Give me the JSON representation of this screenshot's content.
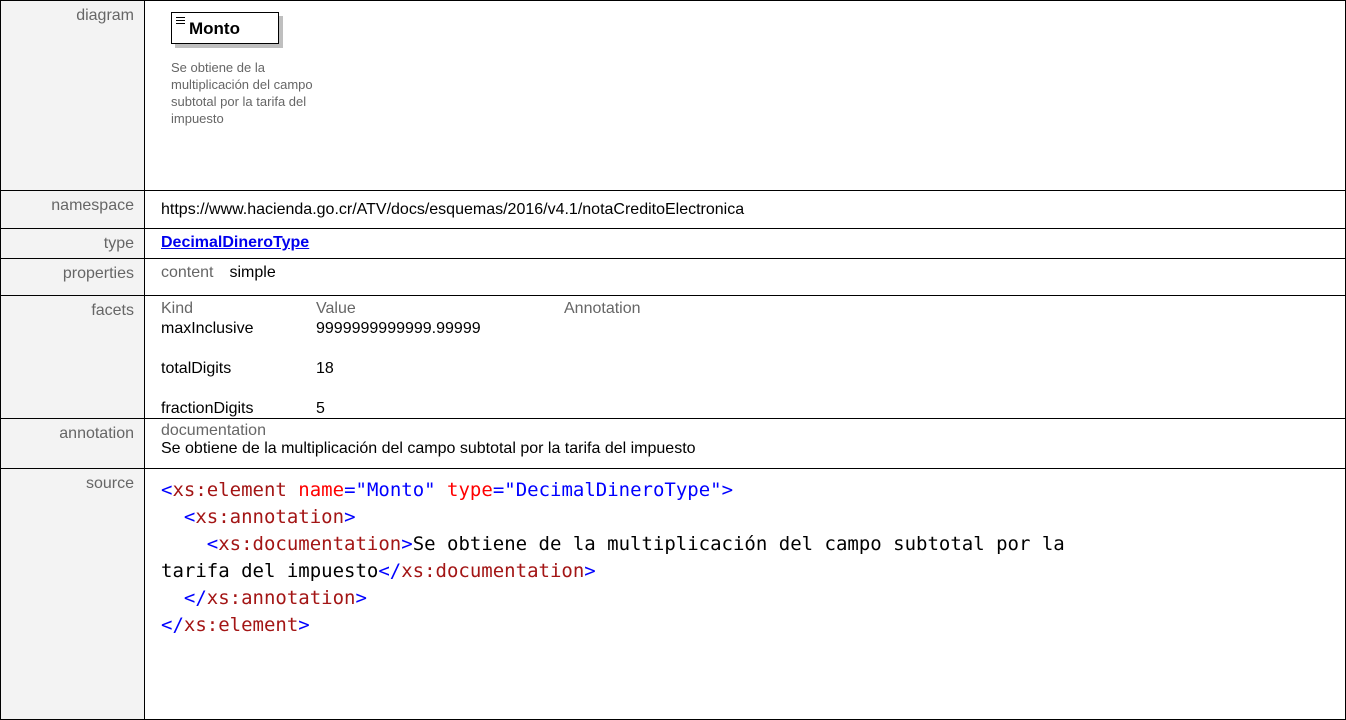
{
  "rows": {
    "diagram": {
      "label": "diagram",
      "element_name": "Monto",
      "doc_lines": [
        "Se obtiene de la",
        "multiplicación del campo",
        "subtotal por la tarifa del",
        "impuesto"
      ]
    },
    "namespace": {
      "label": "namespace",
      "value": "https://www.hacienda.go.cr/ATV/docs/esquemas/2016/v4.1/notaCreditoElectronica"
    },
    "type": {
      "label": "type",
      "value": "DecimalDineroType"
    },
    "properties": {
      "label": "properties",
      "key": "content",
      "value": "simple"
    },
    "facets": {
      "label": "facets",
      "headers": [
        "Kind",
        "Value",
        "Annotation"
      ],
      "items": [
        {
          "kind": "maxInclusive",
          "value": "9999999999999.99999"
        },
        {
          "kind": "totalDigits",
          "value": "18"
        },
        {
          "kind": "fractionDigits",
          "value": "5"
        }
      ]
    },
    "annotation": {
      "label": "annotation",
      "key": "documentation",
      "value": "Se obtiene de la multiplicación del campo subtotal por la tarifa del impuesto"
    },
    "source": {
      "label": "source",
      "line1": {
        "open": "<",
        "tag": "xs:element",
        "attr1": "name",
        "eq1": "=",
        "val1": "\"Monto\"",
        "attr2": "type",
        "eq2": "=",
        "val2": "\"DecimalDineroType\"",
        "close": ">"
      },
      "line2": {
        "open": "<",
        "tag": "xs:annotation",
        "close": ">"
      },
      "line3": {
        "open": "<",
        "tag": "xs:documentation",
        "close": ">",
        "text": "Se obtiene de la multiplicación del campo subtotal por la"
      },
      "line4": {
        "text": "tarifa del impuesto",
        "open": "</",
        "tag": "xs:documentation",
        "close": ">"
      },
      "line5": {
        "open": "</",
        "tag": "xs:annotation",
        "close": ">"
      },
      "line6": {
        "open": "</",
        "tag": "xs:element",
        "close": ">"
      }
    }
  }
}
